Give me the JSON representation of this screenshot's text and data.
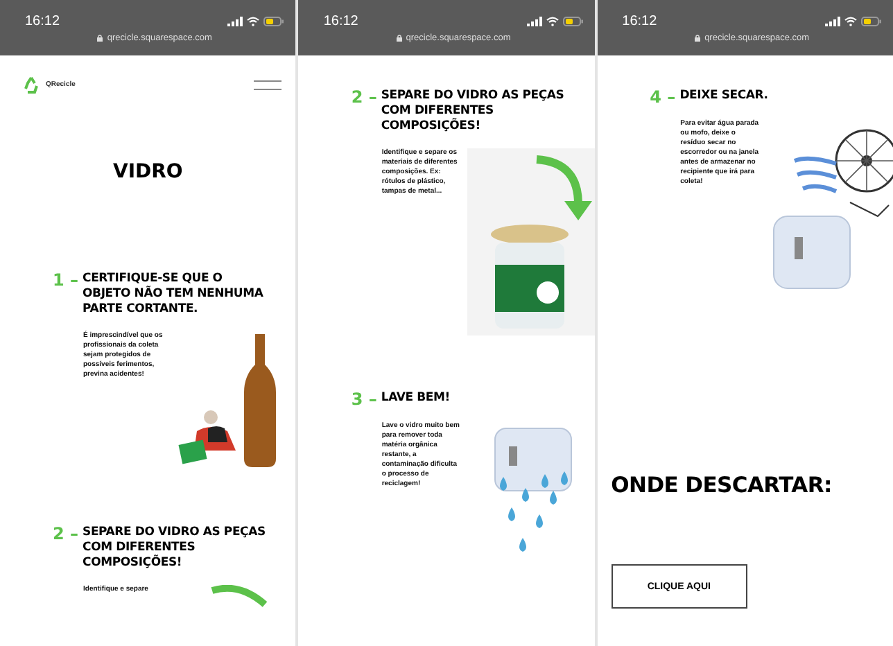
{
  "phones": [
    {
      "time": "16:12",
      "url": "qrecicle.squarespace.com",
      "blocks": [
        {
          "kind": "header",
          "brand": "QRecicle"
        },
        {
          "kind": "title",
          "text": "VIDRO"
        },
        {
          "kind": "step",
          "number": "1",
          "dash": "–",
          "heading": "CERTIFIQUE-SE QUE O OBJETO NÃO TEM NENHUMA PARTE CORTANTE.",
          "body": "É imprescindível que os profissionais da coleta sejam protegidos de possíveis ferimentos, previna acidentes!",
          "illustration": {
            "kind": "bottle"
          }
        },
        {
          "kind": "step",
          "number": "2",
          "dash": "–",
          "heading": "SEPARE DO VIDRO AS PEÇAS COM DIFERENTES COMPOSIÇÕES!",
          "body": "Identifique e separe",
          "illustration": {
            "kind": "arrow"
          }
        }
      ]
    },
    {
      "time": "16:12",
      "url": "qrecicle.squarespace.com",
      "blocks": [
        {
          "kind": "step",
          "number": "2",
          "dash": "–",
          "heading": "SEPARE DO VIDRO AS PEÇAS COM DIFERENTES COMPOSIÇÕES!",
          "body": "Identifique e separe os materiais de diferentes composições. Ex: rótulos de plástico, tampas de metal...",
          "illustration": {
            "kind": "jar"
          }
        },
        {
          "kind": "step",
          "number": "3",
          "dash": "–",
          "heading": "LAVE BEM!",
          "body": "Lave o vidro muito bem para remover toda matéria orgânica restante, a contaminação dificulta o processo de reciclagem!",
          "illustration": {
            "kind": "wash"
          }
        }
      ]
    },
    {
      "time": "16:12",
      "url": "qrecicle.squarespace.com",
      "blocks": [
        {
          "kind": "step",
          "number": "4",
          "dash": "–",
          "heading": "DEIXE SECAR.",
          "body": "Para evitar água parada ou mofo, deixe o resíduo secar no escorredor ou na janela antes de armazenar no recipiente que irá para coleta!",
          "illustration": {
            "kind": "dry"
          }
        },
        {
          "kind": "heading",
          "text": "ONDE DESCARTAR:"
        },
        {
          "kind": "button",
          "label": "CLIQUE AQUI"
        }
      ]
    }
  ]
}
